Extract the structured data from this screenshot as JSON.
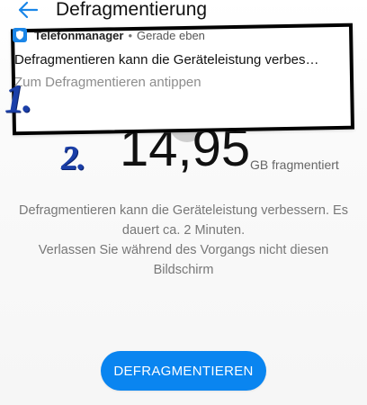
{
  "app_bar": {
    "title": "Defragmentierung",
    "back_icon": "back-arrow-icon"
  },
  "notification": {
    "app_name": "Telefonmanager",
    "separator": "•",
    "time": "Gerade eben",
    "body": "Defragmentieren kann die Geräteleistung verbess…",
    "action": "Zum Defragmentieren antippen",
    "app_icon": "shield-icon"
  },
  "annotations": {
    "first": "1.",
    "second": "2."
  },
  "fragmentation": {
    "value": "14,95",
    "unit": "GB fragmentiert"
  },
  "description": {
    "line1": "Defragmentieren kann die Geräteleistung verbessern. Es dauert ca. 2 Minuten.",
    "line2": "Verlassen Sie während des Vorgangs nicht diesen Bildschirm"
  },
  "button": {
    "label": "DEFRAGMENTIEREN"
  },
  "colors": {
    "accent": "#0A85F0",
    "annotation": "#1B3FA8"
  }
}
